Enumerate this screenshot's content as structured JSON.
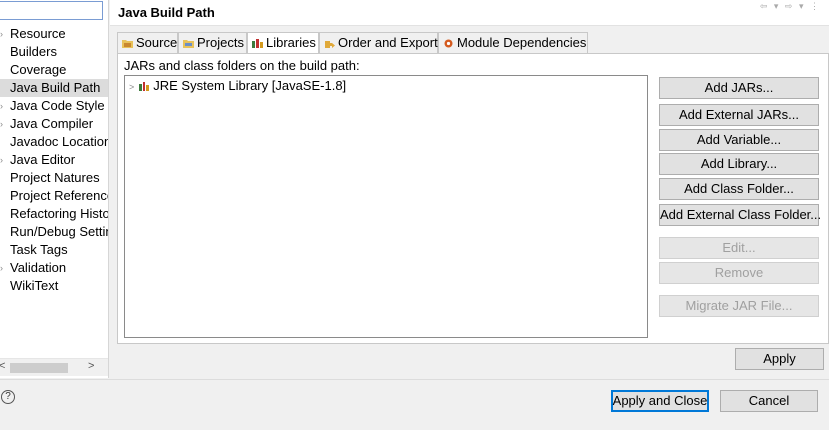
{
  "header": {
    "title": "Java Build Path",
    "nav": "⇦ ▾ ⇨ ▾ ⋮"
  },
  "sidebar": {
    "filter_value": "",
    "items": [
      {
        "label": "Resource",
        "expandable": true
      },
      {
        "label": "Builders",
        "expandable": false
      },
      {
        "label": "Coverage",
        "expandable": false
      },
      {
        "label": "Java Build Path",
        "expandable": false,
        "selected": true
      },
      {
        "label": "Java Code Style",
        "expandable": true
      },
      {
        "label": "Java Compiler",
        "expandable": true
      },
      {
        "label": "Javadoc Location",
        "expandable": false
      },
      {
        "label": "Java Editor",
        "expandable": true
      },
      {
        "label": "Project Natures",
        "expandable": false
      },
      {
        "label": "Project References",
        "expandable": false
      },
      {
        "label": "Refactoring History",
        "expandable": false
      },
      {
        "label": "Run/Debug Settings",
        "expandable": false
      },
      {
        "label": "Task Tags",
        "expandable": false
      },
      {
        "label": "Validation",
        "expandable": true
      },
      {
        "label": "WikiText",
        "expandable": false
      }
    ],
    "scroll_left": "<",
    "scroll_right": ">"
  },
  "tabs": [
    {
      "label": "Source",
      "icon": "source-folder-icon",
      "active": false
    },
    {
      "label": "Projects",
      "icon": "projects-icon",
      "active": false
    },
    {
      "label": "Libraries",
      "icon": "libraries-icon",
      "active": true
    },
    {
      "label": "Order and Export",
      "icon": "order-export-icon",
      "active": false
    },
    {
      "label": "Module Dependencies",
      "icon": "module-dependencies-icon",
      "active": false
    }
  ],
  "main": {
    "list_label": "JARs and class folders on the build path:",
    "libraries": [
      {
        "label": "JRE System Library [JavaSE-1.8]",
        "icon": "library-icon",
        "expand": ">"
      }
    ],
    "buttons": [
      {
        "label": "Add JARs...",
        "enabled": true
      },
      {
        "label": "Add External JARs...",
        "enabled": true
      },
      {
        "label": "Add Variable...",
        "enabled": true
      },
      {
        "label": "Add Library...",
        "enabled": true
      },
      {
        "label": "Add Class Folder...",
        "enabled": true
      },
      {
        "label": "Add External Class Folder...",
        "enabled": true
      },
      {
        "label": "Edit...",
        "enabled": false
      },
      {
        "label": "Remove",
        "enabled": false
      },
      {
        "label": "Migrate JAR File...",
        "enabled": false
      }
    ],
    "apply_label": "Apply"
  },
  "footer": {
    "help_glyph": "?",
    "apply_close_label": "Apply and Close",
    "cancel_label": "Cancel"
  },
  "colors": {
    "selection": "#dcdcdc",
    "focus_border": "#0078d7",
    "disabled_text": "#a0a0a0"
  }
}
